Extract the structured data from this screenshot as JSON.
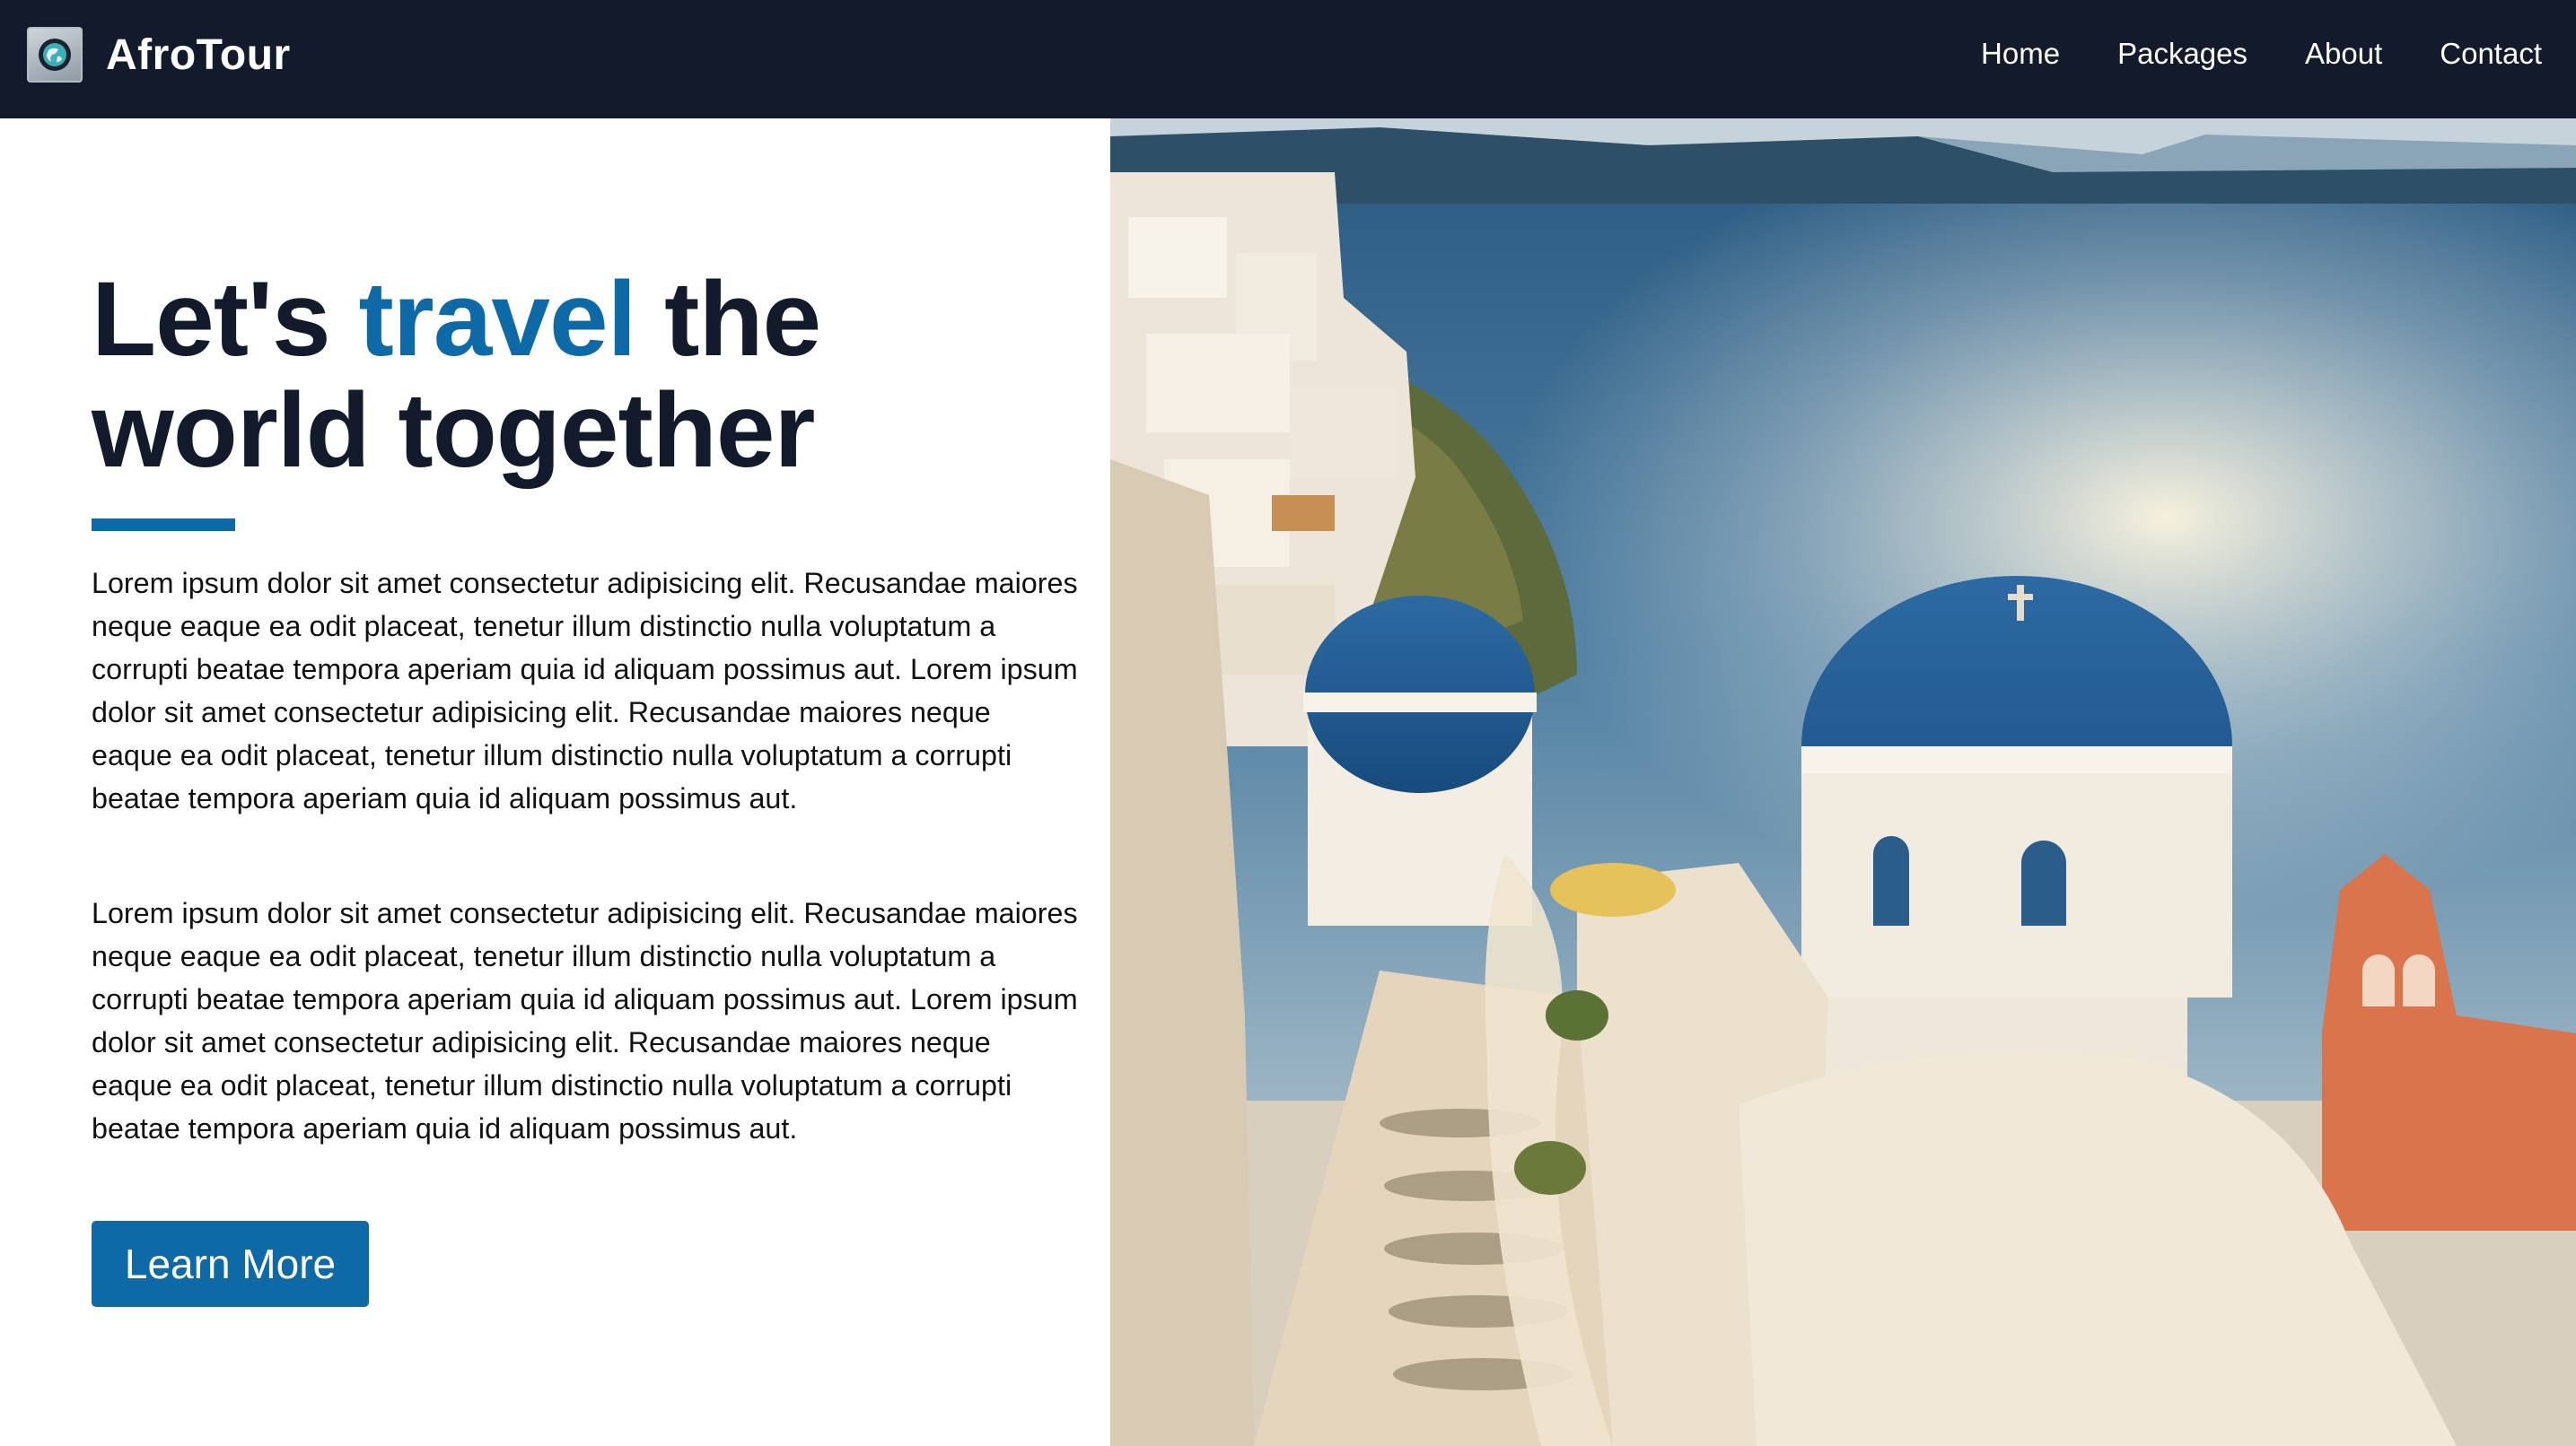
{
  "brand": {
    "name": "AfroTour",
    "logo_icon": "globe-logo-icon"
  },
  "nav": {
    "links": [
      "Home",
      "Packages",
      "About",
      "Contact"
    ]
  },
  "hero": {
    "title_before": "Let's ",
    "title_accent": "travel",
    "title_after": " the world together",
    "paragraphs": [
      "Lorem ipsum dolor sit amet consectetur adipisicing elit. Recusandae maiores neque eaque ea odit placeat, tenetur illum distinctio nulla voluptatum a corrupti beatae tempora aperiam quia id aliquam possimus aut. Lorem ipsum dolor sit amet consectetur adipisicing elit. Recusandae maiores neque eaque ea odit placeat, tenetur illum distinctio nulla voluptatum a corrupti beatae tempora aperiam quia id aliquam possimus aut.",
      "Lorem ipsum dolor sit amet consectetur adipisicing elit. Recusandae maiores neque eaque ea odit placeat, tenetur illum distinctio nulla voluptatum a corrupti beatae tempora aperiam quia id aliquam possimus aut. Lorem ipsum dolor sit amet consectetur adipisicing elit. Recusandae maiores neque eaque ea odit placeat, tenetur illum distinctio nulla voluptatum a corrupti beatae tempora aperiam quia id aliquam possimus aut."
    ],
    "button_label": "Learn More",
    "image_subject": "santorini-blue-domes-photo"
  },
  "colors": {
    "navbar_bg": "#121a2b",
    "accent": "#0e6aa6",
    "title_text": "#121a2b",
    "body_text": "#111111"
  }
}
